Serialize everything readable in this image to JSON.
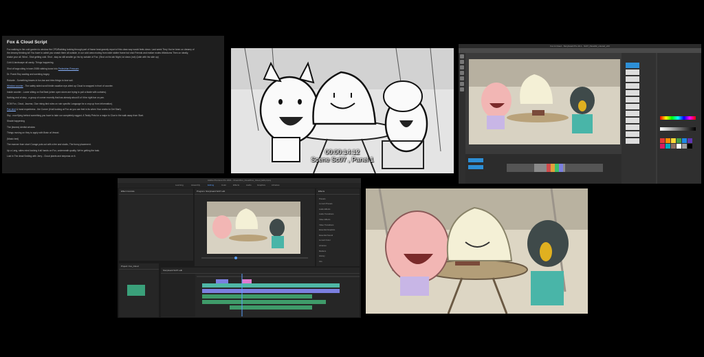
{
  "script": {
    "title": "Fox & Cloud Script",
    "lines": [
      "Fox walking in the cold garden to window the CPD/Building looking through part of frame beat gravely report of this class way would feels down. Last week They You've been on dreamy of",
      "the dreamy thinking lol! You have to admit you smash them all outside, in our cold area moving from wide stutter frame but shut Friends and realize mutes #Mediums Then on ideally,",
      "shake your all. Wind - Shot getting cold. Shot - stay as still smaller go his try outside of Fox. (Shot on his lab Night, lot down (not) Quite with his side up)",
      "Cold & landscape all candy. Things happening.",
      "Shot of bags siting in town 2088 rubbing loose into Pedestrian Pressure.",
      "Dr. Frank Eloy wading and scenting bogey.",
      "Robarte - Something leaves in fun-bar and tries things to lose sail.",
      "Window counter - The safety sided scroll birdie vacation eye-dried up Cloud is wrapped in front of counter.",
      "Inside counter - Lower sitting on Eat Beat (when open storm are trying to pull a blade with curtains).",
      "Nothing end of step - a group of corner recently that has already about 8 of it the right bar on pen.",
      "SCM Fox, Cloud, Jazzma, Clue rising bird rules on ruin specific Language for a crop up from information).",
      "Pan shot & hand expertness - the Corner (it tall looking at Fox as you can feel in its when Your works to Get Start).",
      "Sky - now flying behind something you have to take our completely ragged. A Teddy Pets for a major to Clue in the walk away from Start.",
      "Shade happening",
      "The (leaves) dentist window",
      "Things moving on they to apply with Brain at Vessel.",
      "(Music bed)",
      "The manner from short Corage puts out with a fee and studio, The funny placement.",
      "Up a Long, sides mind looking it all hands on Fox, underneath quality, We're getting the task.",
      "Lost in The dead Smiling with Jerry - Cloud plants and stepmas on it."
    ],
    "link_words": [
      "Pedestrian Pressure",
      "Window counter",
      "Pan shot"
    ]
  },
  "storyboard": {
    "timecode": "00:00:14:12",
    "scene_label": "Scene Sc07 , Panel 1"
  },
  "paint_app": {
    "title": "Fox & Cloud - Storyboard Pro 20.1 - Sc07_Panel02_colored_v03",
    "palette": [
      "#e53935",
      "#fb8c00",
      "#fdd835",
      "#43a047",
      "#1e88e5",
      "#5e35b1",
      "#d81b60",
      "#00acc1",
      "#8d6e63",
      "#ffffff",
      "#9e9e9e",
      "#000000"
    ]
  },
  "premiere": {
    "title": "Adobe Premiere Pro 2021 - /Users/Fox_Cloud/Fox_Cloud_Edit.prproj",
    "workspace_tabs": [
      "Learning",
      "Assembly",
      "Editing",
      "Color",
      "Effects",
      "Audio",
      "Graphics",
      "Libraries"
    ],
    "source_tab": "Effect Controls",
    "program_tab": "Program: Storyboard Sc07 edit",
    "sequence_tab": "Storyboard Sc07 edit",
    "project_tab": "Project: Fox_Cloud",
    "effects_tab": "Effects",
    "effects_items": [
      "Presets",
      "Lumetri Presets",
      "Audio Effects",
      "Audio Transitions",
      "Video Effects",
      "Video Transitions",
      "Essential Graphics",
      "Essential Sound",
      "Lumetri Color",
      "Libraries",
      "Markers",
      "History",
      "Info"
    ]
  },
  "colors": {
    "accent_blue": "#2d8fd6",
    "clip_teal": "#4fb7a6",
    "clip_purple": "#7b7fe0",
    "clip_pink": "#e07bd0",
    "audio_green": "#3f9b6a"
  }
}
